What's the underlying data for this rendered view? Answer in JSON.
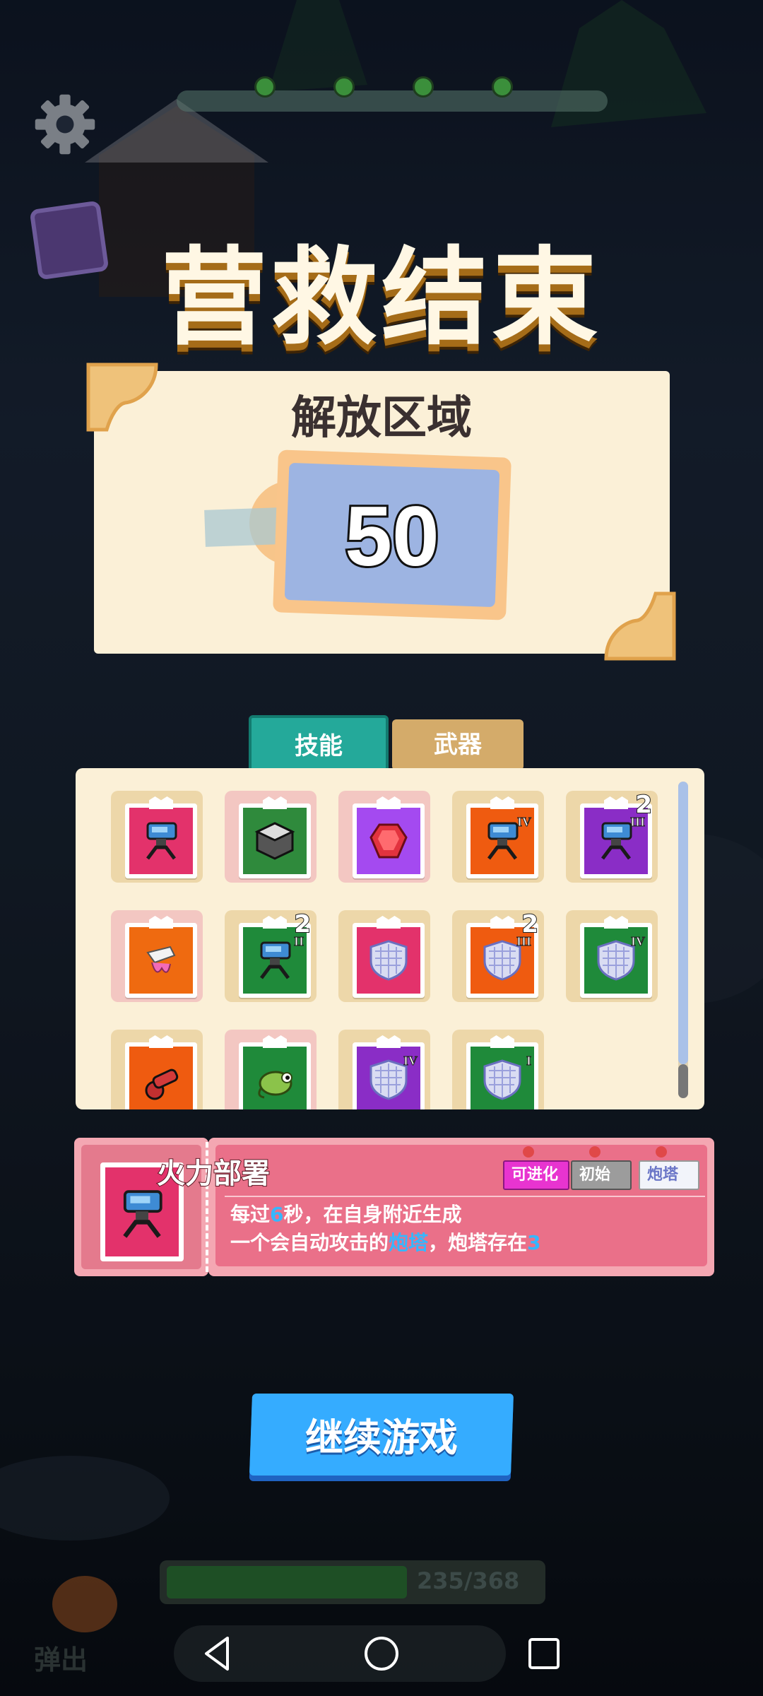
{
  "title": "营救结束",
  "area": {
    "label": "解放区域",
    "value": "50"
  },
  "tabs": {
    "skill": "技能",
    "weapon": "武器"
  },
  "grid": {
    "rows": [
      [
        {
          "name": "turret-card",
          "bg": "#e3326b",
          "slot": "normal"
        },
        {
          "name": "box-card",
          "bg": "#2f8a3c",
          "slot": "rare"
        },
        {
          "name": "gem-card",
          "bg": "#a44af0",
          "slot": "rare"
        },
        {
          "name": "turret-card",
          "bg": "#ef5b10",
          "slot": "normal",
          "roman": "IV"
        },
        {
          "name": "turret-card",
          "bg": "#8a2dc6",
          "slot": "normal",
          "roman": "III",
          "count": "2"
        }
      ],
      [
        {
          "name": "tentacle-card",
          "bg": "#ef6a10",
          "slot": "rare"
        },
        {
          "name": "turret-card",
          "bg": "#1f8a3a",
          "slot": "normal",
          "roman": "II",
          "count": "2"
        },
        {
          "name": "shield-card",
          "bg": "#e3326b",
          "slot": "normal"
        },
        {
          "name": "shield-card",
          "bg": "#ef5b10",
          "slot": "normal",
          "roman": "III",
          "count": "2"
        },
        {
          "name": "shield-card",
          "bg": "#1f8a3a",
          "slot": "normal",
          "roman": "IV"
        }
      ],
      [
        {
          "name": "cannon-card",
          "bg": "#ef5b10",
          "slot": "normal"
        },
        {
          "name": "chameleon-card",
          "bg": "#1f8a3a",
          "slot": "rare"
        },
        {
          "name": "shield-card",
          "bg": "#8a2dc6",
          "slot": "normal",
          "roman": "IV"
        },
        {
          "name": "shield-card",
          "bg": "#1f8a3a",
          "slot": "normal",
          "roman": "I"
        }
      ]
    ]
  },
  "detail": {
    "name": "火力部署",
    "badges": {
      "evolve": "可进化",
      "initial": "初始",
      "turret": "炮塔"
    },
    "line1": {
      "a": "每过",
      "hl": "6",
      "b": "秒，在自身附近生成"
    },
    "line2": {
      "a": "一个会自动攻击的",
      "hl": "炮塔",
      "b": "，炮塔存在",
      "hl2": "3"
    }
  },
  "continue_label": "继续游戏",
  "bottom": {
    "progress_text": "235/368",
    "eject": "弹出"
  },
  "colors": {
    "accent_teal": "#24a99a",
    "button_blue": "#35acff",
    "card_cream": "#fbf0d7"
  }
}
